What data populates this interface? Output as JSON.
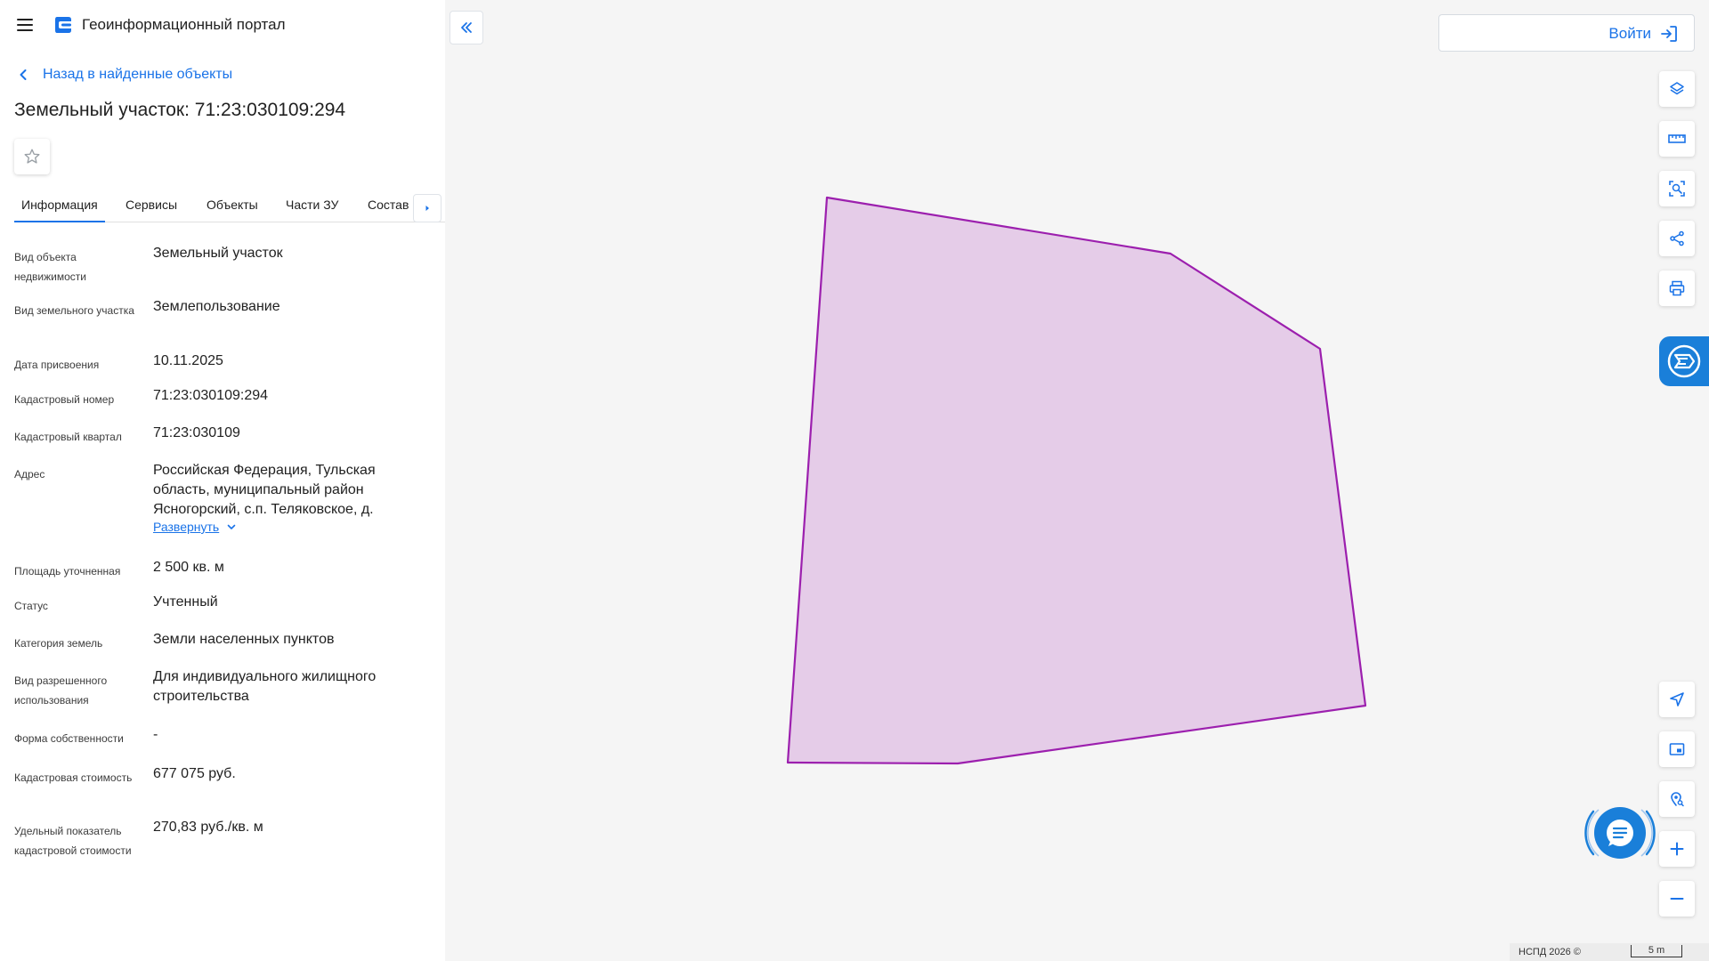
{
  "app": {
    "title": "Геоинформационный портал",
    "accent_color": "#1a73e8"
  },
  "navigation": {
    "back_label": "Назад в найденные объекты"
  },
  "object": {
    "title": "Земельный участок: 71:23:030109:294"
  },
  "tabs": [
    {
      "label": "Информация",
      "active": true
    },
    {
      "label": "Сервисы",
      "active": false
    },
    {
      "label": "Объекты",
      "active": false
    },
    {
      "label": "Части ЗУ",
      "active": false
    },
    {
      "label": "Состав",
      "active": false
    }
  ],
  "properties": [
    {
      "label": "Вид объекта недвижимости",
      "value": "Земельный участок"
    },
    {
      "label": "Вид земельного участка",
      "value": "Землепользование"
    },
    {
      "label": "Дата присвоения",
      "value": "10.11.2025"
    },
    {
      "label": "Кадастровый номер",
      "value": "71:23:030109:294"
    },
    {
      "label": "Кадастровый квартал",
      "value": "71:23:030109"
    },
    {
      "label": "Адрес",
      "value": "Российская Федерация, Тульская область, муниципальный район Ясногорский, с.п. Теляковское, д."
    },
    {
      "label": "Площадь уточненная",
      "value": "2 500 кв. м"
    },
    {
      "label": "Статус",
      "value": "Учтенный"
    },
    {
      "label": "Категория земель",
      "value": "Земли населенных пунктов"
    },
    {
      "label": "Вид разрешенного использования",
      "value": "Для индивидуального жилищного строительства"
    },
    {
      "label": "Форма собственности",
      "value": "-"
    },
    {
      "label": "Кадастровая стоимость",
      "value": "677 075 руб."
    },
    {
      "label": "Удельный показатель кадастровой стоимости",
      "value": "270,83 руб./кв. м"
    }
  ],
  "address_expand_label": "Развернуть",
  "map": {
    "login_label": "Войти",
    "parcel_fill": "#e5cce8",
    "parcel_stroke": "#9c1fae",
    "tools": [
      "layers-icon",
      "ruler-icon",
      "area-select-icon",
      "share-icon",
      "print-icon"
    ],
    "bottom_tools": [
      "navigate-icon",
      "minimap-icon",
      "location-search-icon",
      "zoom-in-icon",
      "zoom-out-icon"
    ],
    "copyright": "НСПД 2026 ©",
    "scale_label": "5 m"
  }
}
